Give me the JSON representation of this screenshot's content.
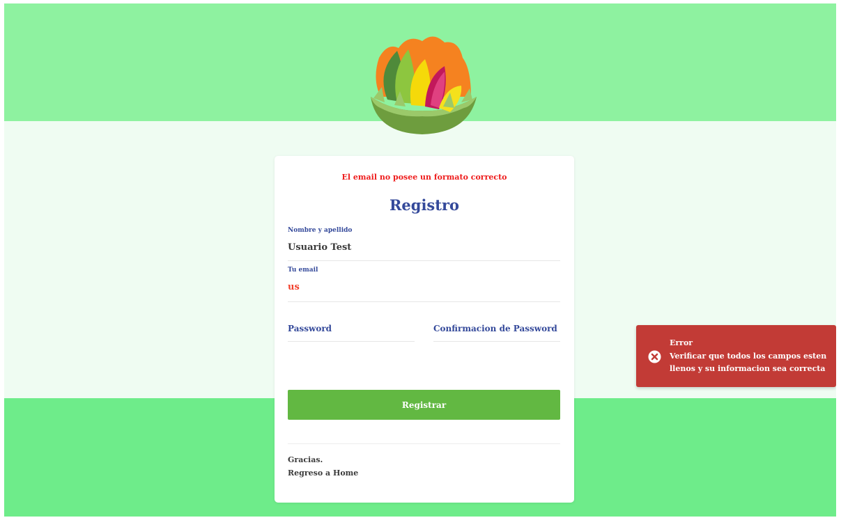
{
  "form": {
    "error_message": "El email no posee un formato correcto",
    "title": "Registro",
    "name_label": "Nombre y apellido",
    "name_value": "Usuario Test",
    "email_label": "Tu email",
    "email_value": "us",
    "password_label": "Password",
    "confirm_password_label": "Confirmacion de Password",
    "submit_label": "Registrar",
    "footer_thanks": "Gracias.",
    "footer_home_link": "Regreso a Home"
  },
  "toast": {
    "title": "Error",
    "message_line1": "Verificar que todos los campos esten",
    "message_line2": "llenos y su informacion sea correcta",
    "icon": "error-circle-x-icon"
  },
  "colors": {
    "band_top": "#8ef2a0",
    "band_middle": "#effcf2",
    "band_bottom": "#6eec8a",
    "primary_text": "#34499a",
    "error_text": "#ee1b1b",
    "button": "#62b842",
    "toast_background": "#c23b36"
  },
  "logo": {
    "icon": "fruit-bowl-logo"
  }
}
